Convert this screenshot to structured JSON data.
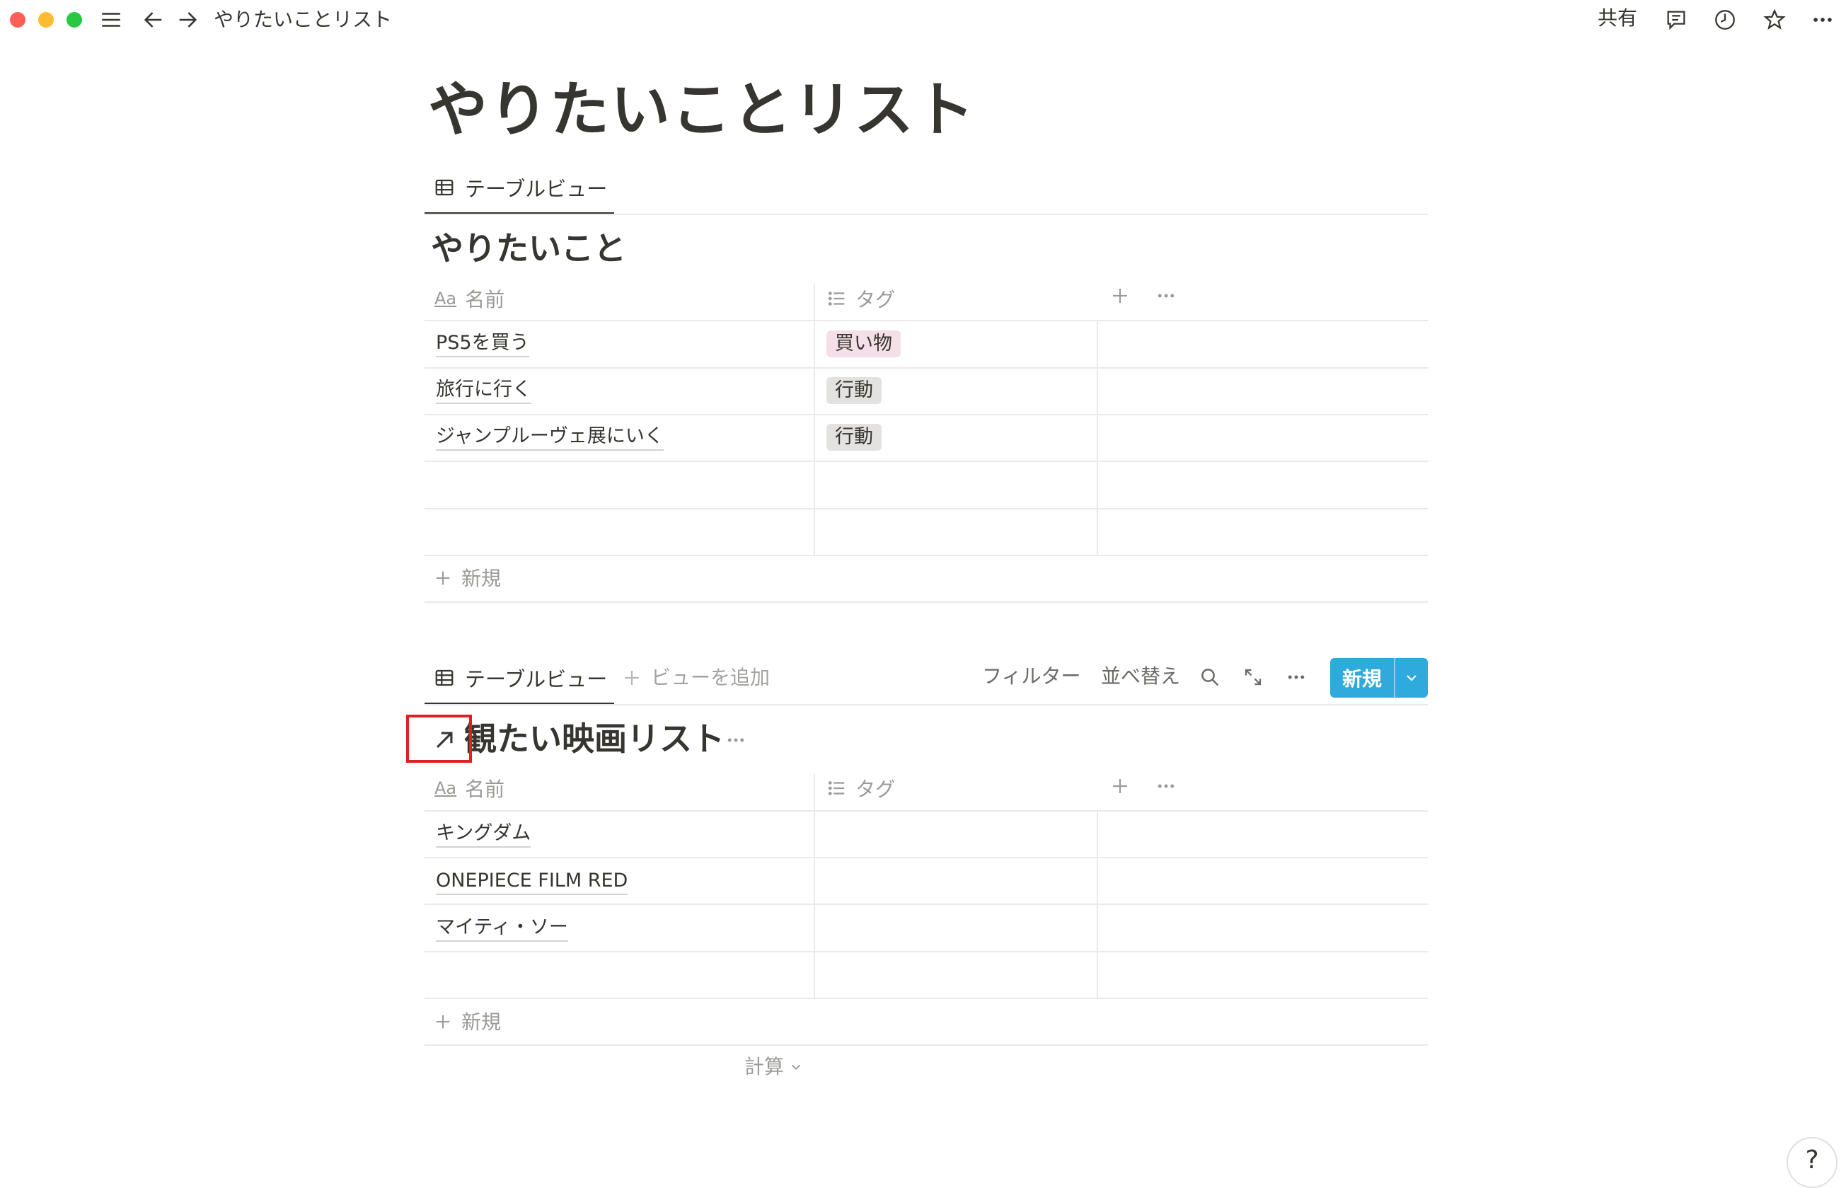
{
  "window": {
    "breadcrumb": "やりたいことリスト",
    "share_label": "共有"
  },
  "colors": {
    "accent": "#2eaadc",
    "tag_pink": "#f5e0e9",
    "tag_gray": "#e3e2e0",
    "highlight": "#e02020"
  },
  "icons": [
    "menu-icon",
    "back-arrow-icon",
    "forward-arrow-icon",
    "comment-icon",
    "clock-icon",
    "star-icon",
    "more-icon",
    "table-icon",
    "text-property-icon",
    "list-property-icon",
    "plus-icon",
    "search-icon",
    "expand-icon",
    "chevron-down-icon",
    "open-link-arrow-icon"
  ],
  "page": {
    "title": "やりたいことリスト"
  },
  "db1": {
    "view_tab": "テーブルビュー",
    "title": "やりたいこと",
    "columns": {
      "name": "名前",
      "tag": "タグ"
    },
    "rows": [
      {
        "name": "PS5を買う",
        "tag": "買い物",
        "tag_color": "#f5e0e9"
      },
      {
        "name": "旅行に行く",
        "tag": "行動",
        "tag_color": "#e3e2e0"
      },
      {
        "name": "ジャンプルーヴェ展にいく",
        "tag": "行動",
        "tag_color": "#e3e2e0"
      }
    ],
    "new_label": "新規"
  },
  "db2": {
    "view_tab": "テーブルビュー",
    "add_view": "ビューを追加",
    "filter": "フィルター",
    "sort": "並べ替え",
    "new_button": "新規",
    "title": "観たい映画リスト",
    "columns": {
      "name": "名前",
      "tag": "タグ"
    },
    "rows": [
      {
        "name": "キングダム"
      },
      {
        "name": "ONEPIECE FILM RED"
      },
      {
        "name": "マイティ・ソー"
      }
    ],
    "new_label": "新規",
    "calc_label": "計算"
  },
  "help": "?"
}
